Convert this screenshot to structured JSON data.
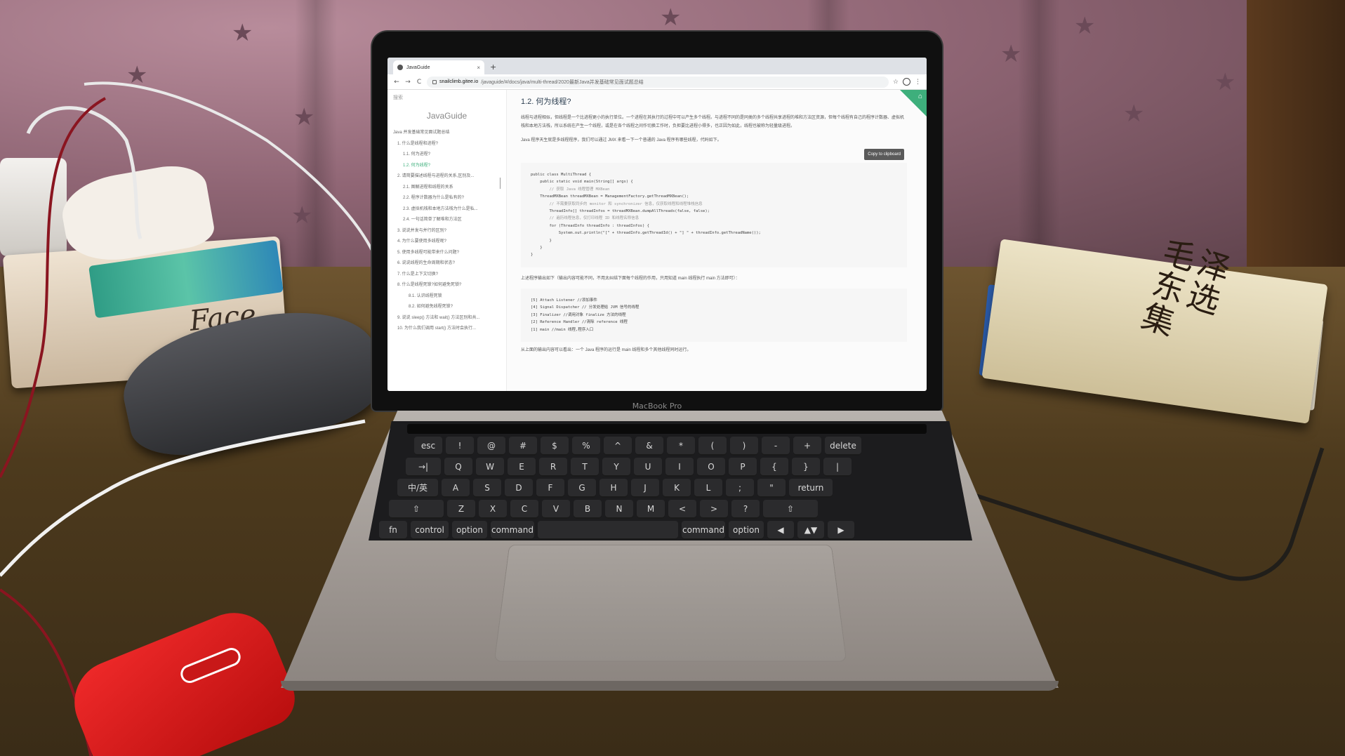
{
  "scene": {
    "laptop_label": "MacBook Pro",
    "tissue_brand": "Face",
    "book_title": "毛泽东选集"
  },
  "browser": {
    "tab": {
      "title": "JavaGuide",
      "close": "×"
    },
    "new_tab": "+",
    "nav": {
      "back": "←",
      "forward": "→",
      "reload": "C"
    },
    "url": {
      "host": "snailclimb.gitee.io",
      "path": "/javaguide/#/docs/java/multi-thread/2020最新Java并发基础常见面试题总结"
    },
    "icons": {
      "star": "☆",
      "menu": "⋮"
    }
  },
  "sidebar": {
    "search_label": "搜索",
    "site_title": "JavaGuide",
    "items": [
      {
        "text": "Java 并发基础常见面试题总结",
        "level": "l0",
        "active": false
      },
      {
        "text": "1. 什么是线程和进程?",
        "level": "l1",
        "active": false
      },
      {
        "text": "1.1. 何为进程?",
        "level": "l2",
        "active": false
      },
      {
        "text": "1.2. 何为线程?",
        "level": "l2",
        "active": true
      },
      {
        "text": "2. 请简要描述线程与进程的关系,区别及...",
        "level": "l1",
        "active": false
      },
      {
        "text": "2.1. 图解进程和线程的关系",
        "level": "l2",
        "active": false
      },
      {
        "text": "2.2. 程序计数器为什么是私有的?",
        "level": "l2",
        "active": false
      },
      {
        "text": "2.3. 虚拟机栈和本地方法栈为什么是私...",
        "level": "l2",
        "active": false
      },
      {
        "text": "2.4. 一句话简单了解堆和方法区",
        "level": "l2",
        "active": false
      },
      {
        "text": "3. 说说并发与并行的区别?",
        "level": "l1",
        "active": false
      },
      {
        "text": "4. 为什么要使用多线程呢?",
        "level": "l1",
        "active": false
      },
      {
        "text": "5. 使用多线程可能带来什么问题?",
        "level": "l1",
        "active": false
      },
      {
        "text": "6. 说说线程的生命周期和状态?",
        "level": "l1",
        "active": false
      },
      {
        "text": "7. 什么是上下文切换?",
        "level": "l1",
        "active": false
      },
      {
        "text": "8. 什么是线程死锁?如何避免死锁?",
        "level": "l1",
        "active": false
      },
      {
        "text": "8.1. 认识线程死锁",
        "level": "l3",
        "active": false
      },
      {
        "text": "8.2. 如何避免线程死锁?",
        "level": "l3",
        "active": false
      },
      {
        "text": "9. 说说 sleep() 方法和 wait() 方法区别和共...",
        "level": "l1",
        "active": false
      },
      {
        "text": "10. 为什么我们调用 start() 方法时会执行...",
        "level": "l1",
        "active": false
      }
    ]
  },
  "content": {
    "heading": "1.2. 何为线程?",
    "para1": "线程与进程相似，但线程是一个比进程更小的执行单位。一个进程在其执行的过程中可以产生多个线程。与进程不同的是同类的多个线程共享进程的堆和方法区资源，但每个线程有自己的程序计数器、虚拟机栈和本地方法栈，所以系统在产生一个线程，或是在各个线程之间作切换工作时，负担要比进程小得多，也正因为如此，线程也被称为轻量级进程。",
    "para2": "Java 程序天生就是多线程程序，我们可以通过 JMX 来看一下一个普通的 Java 程序有哪些线程，代码如下。",
    "copy_button": "Copy to clipboard",
    "code_lines": [
      "public class MultiThread {",
      "    public static void main(String[] args) {",
      "        // 获取 Java 线程管理 MXBean",
      "    ThreadMXBean threadMXBean = ManagementFactory.getThreadMXBean();",
      "        // 不需要获取同步的 monitor 和 synchronizer 信息，仅获取线程和线程堆栈信息",
      "        ThreadInfo[] threadInfos = threadMXBean.dumpAllThreads(false, false);",
      "        // 遍历线程信息，仅打印线程 ID 和线程名称信息",
      "        for (ThreadInfo threadInfo : threadInfos) {",
      "            System.out.println(\"[\" + threadInfo.getThreadId() + \"] \" + threadInfo.getThreadName());",
      "        }",
      "    }",
      "}"
    ],
    "para3": "上述程序输出如下（输出内容可能不同，不用太纠结下面每个线程的作用，只用知道 main 线程执行 main 方法即可）：",
    "output_lines": [
      "[5] Attach Listener //添加事件",
      "[4] Signal Dispatcher // 分发处理给 JVM 信号的线程",
      "[3] Finalizer //调用对象 finalize 方法的线程",
      "[2] Reference Handler //清除 reference 线程",
      "[1] main //main 线程,程序入口"
    ],
    "para4": "从上面的输出内容可以看出：一个 Java 程序的运行是 main 线程和多个其他线程同时运行。"
  },
  "keyboard": {
    "row1": [
      "esc",
      "!",
      "@",
      "#",
      "$",
      "%",
      "^",
      "&",
      "*",
      "(",
      ")",
      "-",
      "+",
      "delete"
    ],
    "row2": [
      "→|",
      "Q",
      "W",
      "E",
      "R",
      "T",
      "Y",
      "U",
      "I",
      "O",
      "P",
      "{",
      "}",
      "|"
    ],
    "row3": [
      "中/英",
      "A",
      "S",
      "D",
      "F",
      "G",
      "H",
      "J",
      "K",
      "L",
      ";",
      "\"",
      "return"
    ],
    "row4": [
      "⇧",
      "Z",
      "X",
      "C",
      "V",
      "B",
      "N",
      "M",
      "<",
      ">",
      "?",
      "⇧"
    ],
    "row5": [
      "fn",
      "control",
      "option",
      "command",
      "",
      "command",
      "option",
      "◀",
      "▲▼",
      "▶"
    ]
  }
}
